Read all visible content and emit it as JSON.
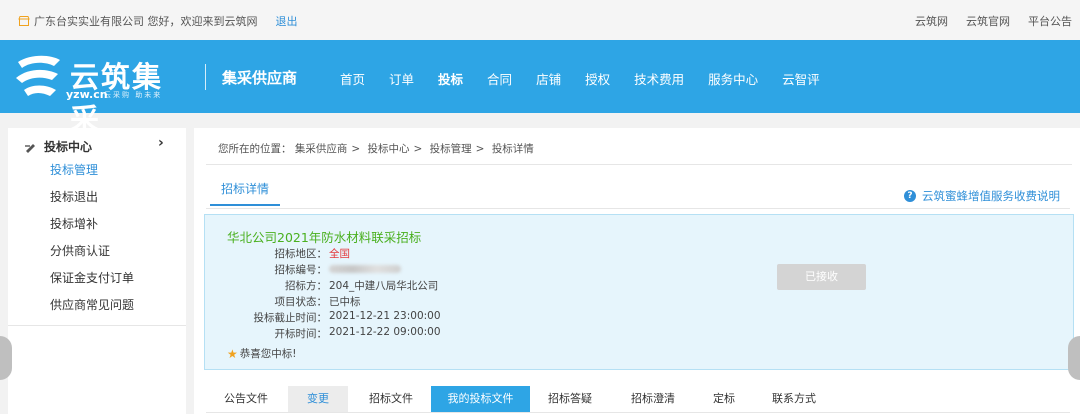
{
  "topbar": {
    "welcome": "广东台实实业有限公司 您好，欢迎来到云筑网",
    "logout": "退出",
    "links": [
      "云筑网",
      "云筑官网",
      "平台公告"
    ]
  },
  "header": {
    "logo_title": "云筑集采",
    "logo_domain": "yzw.cn",
    "logo_slogan": "云采购 助未来",
    "role": "集采供应商",
    "nav": [
      "首页",
      "订单",
      "投标",
      "合同",
      "店铺",
      "授权",
      "技术费用",
      "服务中心",
      "云智评"
    ],
    "active_nav": "投标"
  },
  "sidebar": {
    "section": "投标中心",
    "items": [
      "投标管理",
      "投标退出",
      "投标增补",
      "分供商认证",
      "保证金支付订单",
      "供应商常见问题"
    ],
    "active_item": "投标管理"
  },
  "breadcrumb": {
    "prefix": "您所在的位置：",
    "items": [
      "集采供应商",
      "投标中心",
      "投标管理",
      "投标详情"
    ]
  },
  "page": {
    "tab_title": "招标详情",
    "help_link": "云筑蜜蜂增值服务收费说明"
  },
  "tender": {
    "title": "华北公司2021年防水材料联采招标",
    "fields": [
      {
        "label": "招标地区：",
        "value": "全国"
      },
      {
        "label": "招标编号：",
        "value": ""
      },
      {
        "label": "招标方：",
        "value": "204_中建八局华北公司"
      },
      {
        "label": "项目状态：",
        "value": "已中标"
      },
      {
        "label": "投标截止时间：",
        "value": "2021-12-21 23:00:00"
      },
      {
        "label": "开标时间：",
        "value": "2021-12-22 09:00:00"
      }
    ],
    "status_button": "已接收",
    "congrats": "恭喜您中标!"
  },
  "bottom_tabs": [
    "公告文件",
    "变更",
    "招标文件",
    "我的投标文件",
    "招标答疑",
    "招标澄清",
    "定标",
    "联系方式"
  ],
  "colors": {
    "brand_blue": "#2ea5e5",
    "link_blue": "#2f8fd8",
    "title_green": "#4ab01f",
    "region_red": "#e4393c",
    "star_orange": "#f0a21e"
  }
}
